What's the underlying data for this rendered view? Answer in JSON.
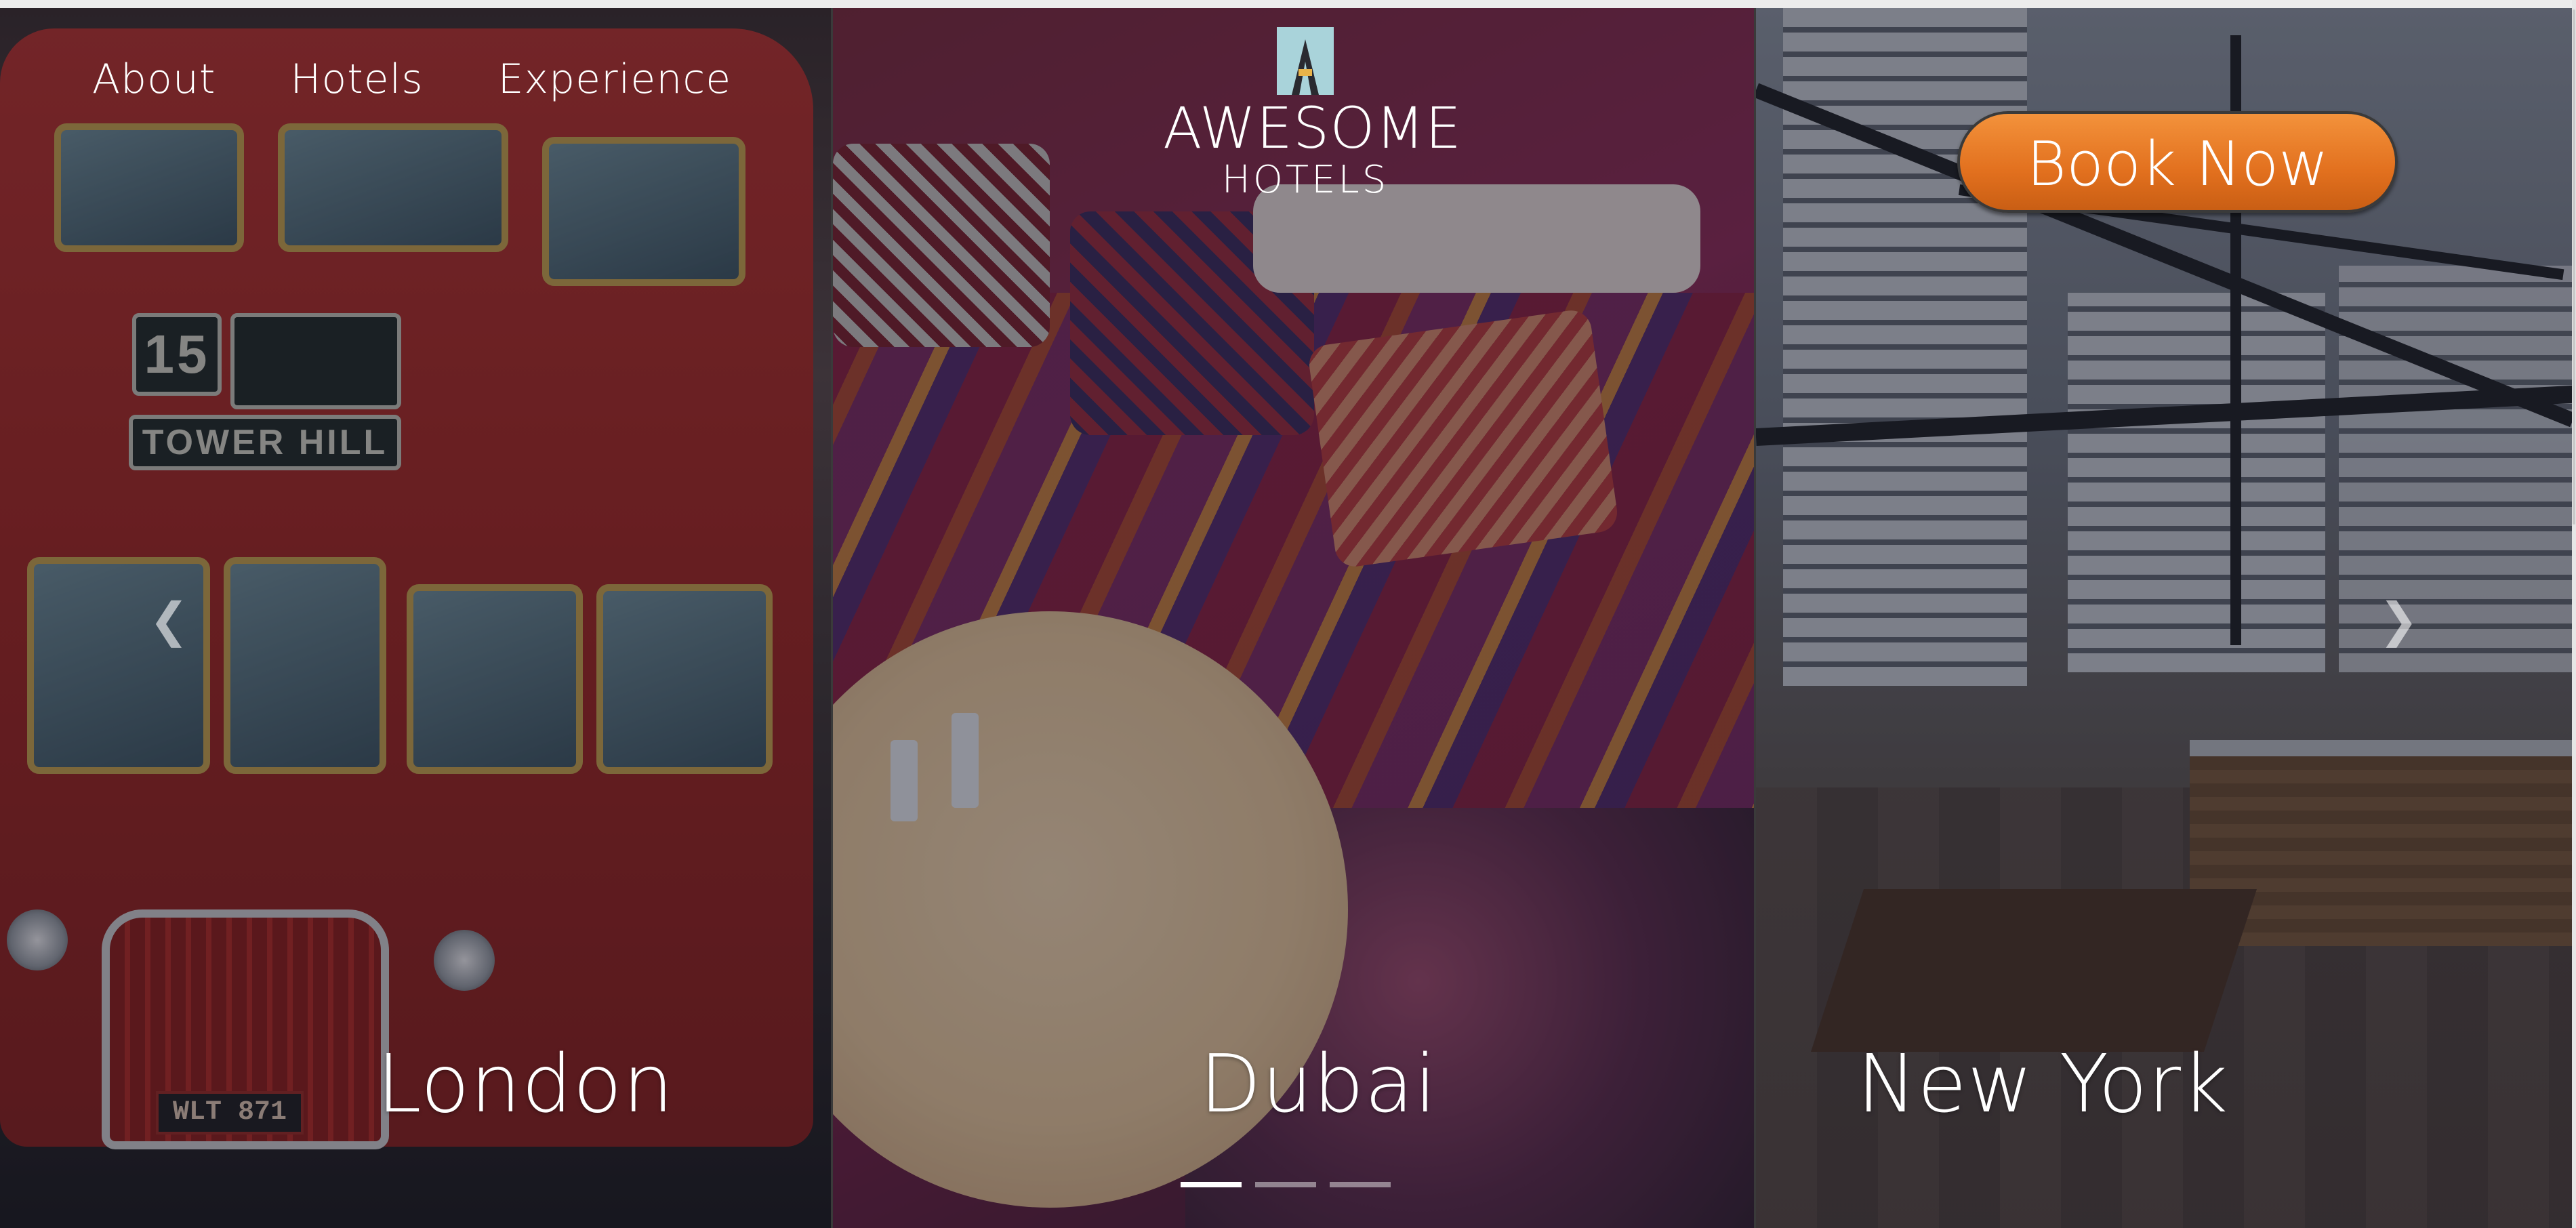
{
  "nav": {
    "links": [
      {
        "label": "About"
      },
      {
        "label": "Hotels"
      },
      {
        "label": "Experience"
      }
    ]
  },
  "logo": {
    "title": "AWESOME",
    "subtitle": "HOTELS",
    "mark_color": "#a9d3da",
    "accent_color": "#e8b34a"
  },
  "cta": {
    "label": "Book Now",
    "color": "#e2701e"
  },
  "panels": [
    {
      "city": "London",
      "scene": "red double-decker bus",
      "bus_route": "15",
      "bus_destination": "TOWER HILL",
      "plate": "WLT 871"
    },
    {
      "city": "Dubai",
      "scene": "colourful cushioned lounge with round table and candles"
    },
    {
      "city": "New York",
      "scene": "rooftop bar terrace with tables"
    }
  ],
  "carousel": {
    "prev_icon": "chevron-left-icon",
    "next_icon": "chevron-right-icon",
    "indicators": 3,
    "active_index": 0
  },
  "colors": {
    "overlay": "#14122380",
    "text": "#ffffff"
  }
}
